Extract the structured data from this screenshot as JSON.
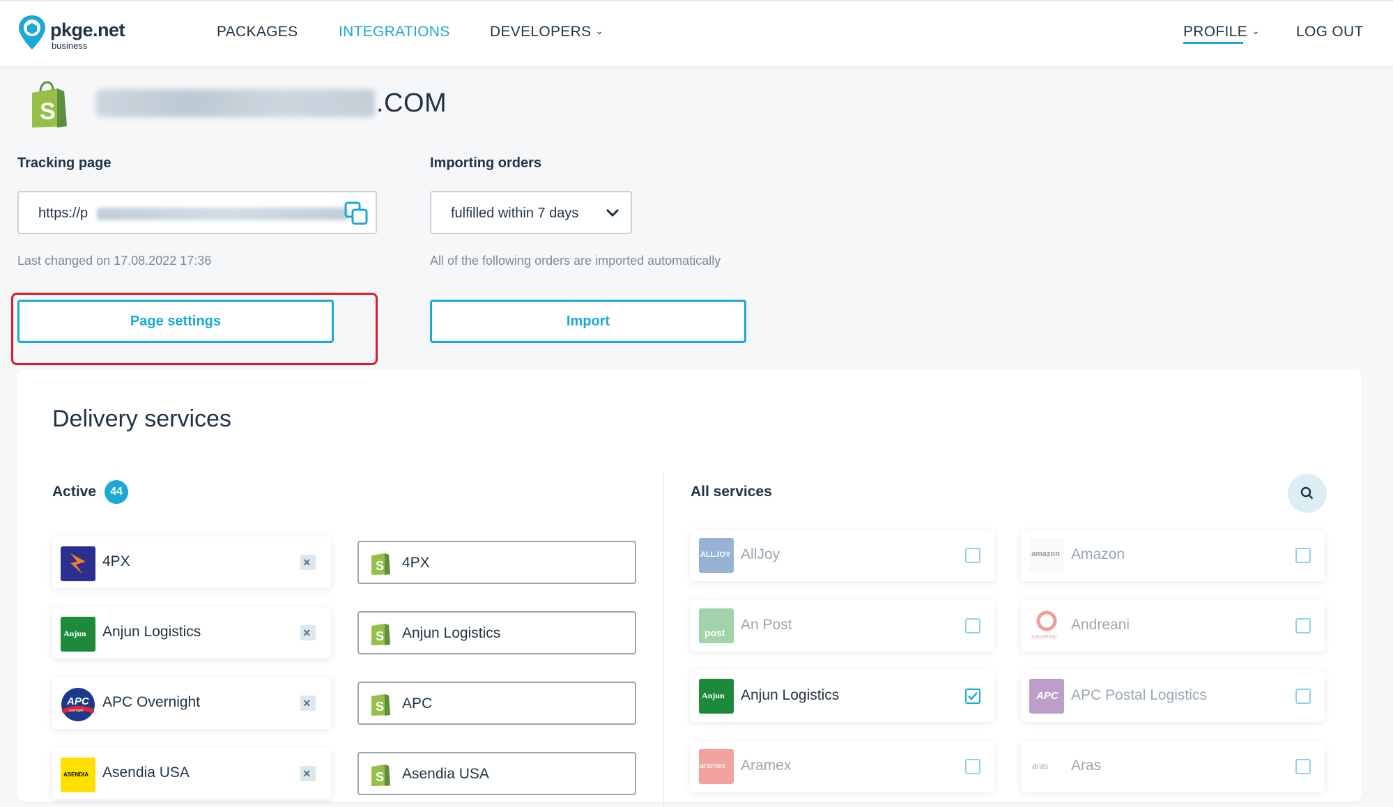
{
  "header": {
    "logo_text": "pkge.net",
    "logo_sub": "business",
    "nav": [
      "PACKAGES",
      "INTEGRATIONS",
      "DEVELOPERS"
    ],
    "profile": "PROFILE",
    "logout": "LOG OUT",
    "active_nav": "INTEGRATIONS",
    "accent": "#1aa8d6"
  },
  "store": {
    "domain_visible_suffix": ".COM",
    "platform_icon": "shopify-bag-icon"
  },
  "tracking": {
    "label": "Tracking page",
    "url_prefix": "https://p",
    "last_changed": "Last changed on 17.08.2022 17:36",
    "button": "Page settings"
  },
  "importing": {
    "label": "Importing orders",
    "selected": "fulfilled within 7 days",
    "note": "All of the following orders are imported automatically",
    "button": "Import"
  },
  "delivery": {
    "title": "Delivery services",
    "active_label": "Active",
    "active_count": "44",
    "active": [
      {
        "name": "4PX",
        "mapped": "4PX"
      },
      {
        "name": "Anjun Logistics",
        "mapped": "Anjun Logistics"
      },
      {
        "name": "APC Overnight",
        "mapped": "APC"
      },
      {
        "name": "Asendia USA",
        "mapped": "Asendia USA"
      }
    ],
    "all_label": "All services",
    "all": [
      {
        "name": "AllJoy",
        "checked": false,
        "logo": "ALLJOY"
      },
      {
        "name": "Amazon",
        "checked": false,
        "logo": "amazon"
      },
      {
        "name": "An Post",
        "checked": false,
        "logo": "post"
      },
      {
        "name": "Andreani",
        "checked": false,
        "logo": "ANDREANI"
      },
      {
        "name": "Anjun Logistics",
        "checked": true,
        "logo": "Anjun"
      },
      {
        "name": "APC Postal Logistics",
        "checked": false,
        "logo": "APC"
      },
      {
        "name": "Aramex",
        "checked": false,
        "logo": "aramex"
      },
      {
        "name": "Aras",
        "checked": false,
        "logo": "aras"
      }
    ],
    "remove_glyph": "×",
    "logo_labels": {
      "anjun": "Anjun",
      "apc": "APC",
      "asendia": "ASENDIA",
      "apc_sub": "overnight"
    }
  }
}
